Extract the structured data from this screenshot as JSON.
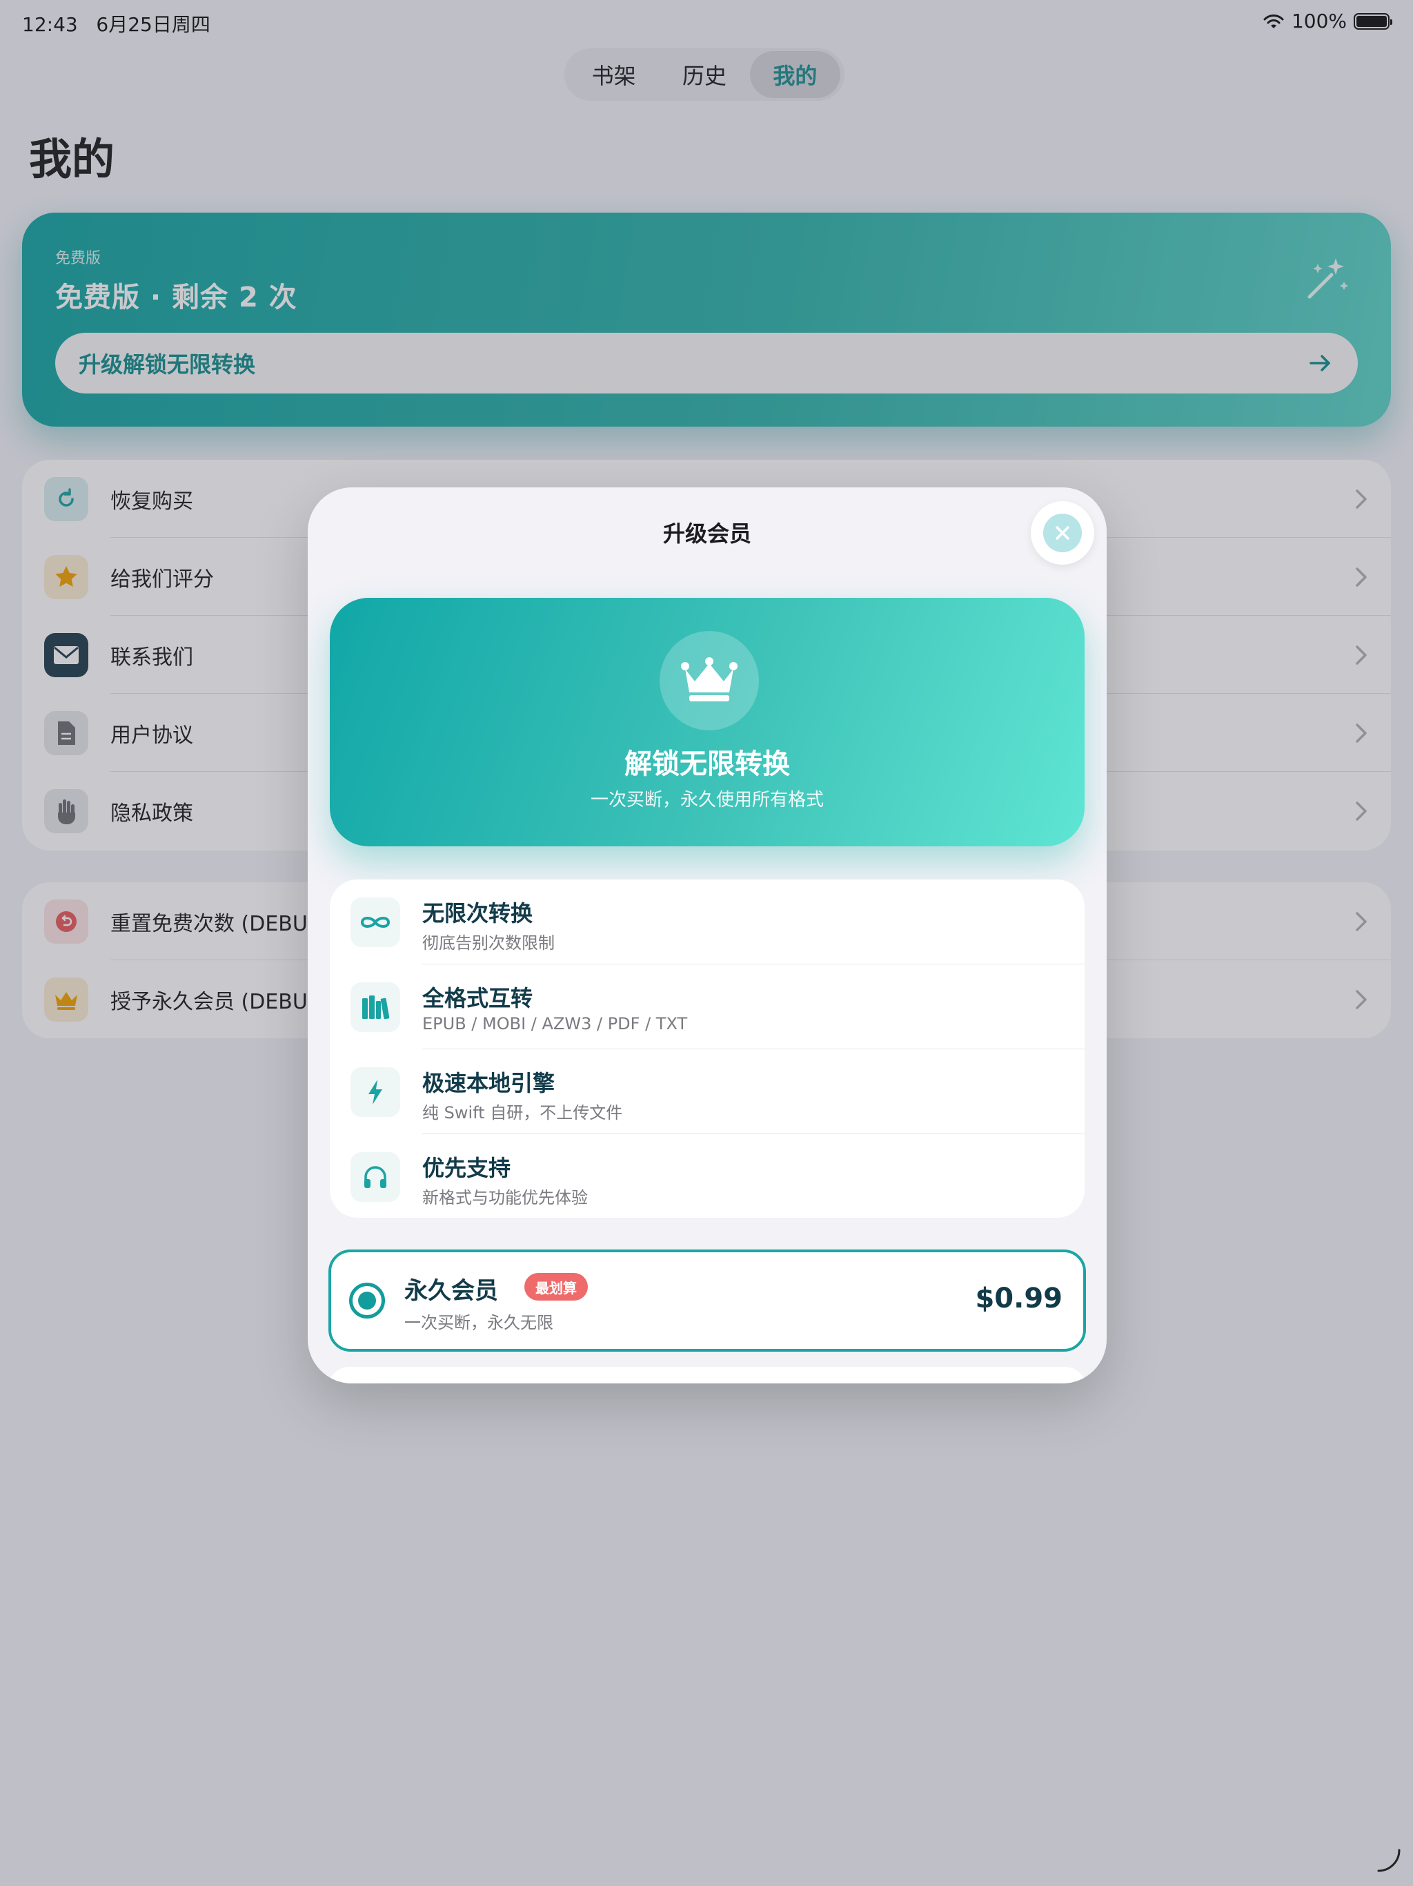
{
  "status_bar": {
    "time": "12:43",
    "date": "6月25日周四",
    "battery": "100%"
  },
  "tabs": [
    {
      "label": "书架",
      "active": false
    },
    {
      "label": "历史",
      "active": false
    },
    {
      "label": "我的",
      "active": true
    }
  ],
  "page": {
    "title": "我的"
  },
  "membership_card": {
    "tier_label": "免费版",
    "status": "免费版 · 剩余 2 次",
    "upgrade_label": "升级解锁无限转换"
  },
  "settings_list": [
    {
      "label": "恢复购买",
      "icon": "refresh-icon",
      "color": "#1aa3a3",
      "bg": "#d7eeee"
    },
    {
      "label": "给我们评分",
      "icon": "star-icon",
      "color": "#f2a300",
      "bg": "#fbeed3"
    },
    {
      "label": "联系我们",
      "icon": "mail-icon",
      "color": "#ffffff",
      "bg": "#1f3d4d"
    },
    {
      "label": "用户协议",
      "icon": "document-icon",
      "color": "#6e6e73",
      "bg": "#e6e6ea"
    },
    {
      "label": "隐私政策",
      "icon": "hand-icon",
      "color": "#6e6e73",
      "bg": "#e6e6ea"
    }
  ],
  "debug_list": [
    {
      "label": "重置免费次数 (DEBUG)",
      "icon": "undo-icon",
      "color": "#e85a5a",
      "bg": "#fbe3e3"
    },
    {
      "label": "授予永久会员 (DEBUG)",
      "icon": "crown-icon",
      "color": "#f2a300",
      "bg": "#fbeed3"
    }
  ],
  "modal": {
    "title": "升级会员",
    "promo": {
      "title": "解锁无限转换",
      "subtitle": "一次买断，永久使用所有格式"
    },
    "features": [
      {
        "title": "无限次转换",
        "subtitle": "彻底告别次数限制",
        "icon": "infinity-icon"
      },
      {
        "title": "全格式互转",
        "subtitle": "EPUB / MOBI / AZW3 / PDF / TXT",
        "icon": "books-icon"
      },
      {
        "title": "极速本地引擎",
        "subtitle": "纯 Swift 自研，不上传文件",
        "icon": "bolt-icon"
      },
      {
        "title": "优先支持",
        "subtitle": "新格式与功能优先体验",
        "icon": "headphones-icon"
      }
    ],
    "plan": {
      "name": "永久会员",
      "badge": "最划算",
      "description": "一次买断，永久无限",
      "price": "$0.99",
      "selected": true
    }
  },
  "colors": {
    "accent": "#1aa3a3",
    "badge": "#ef6a6a",
    "text_dark": "#123b4a"
  }
}
